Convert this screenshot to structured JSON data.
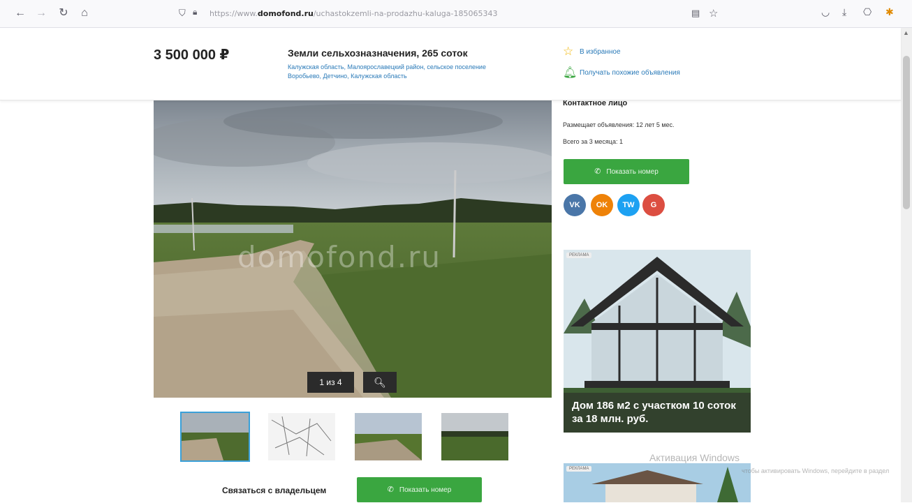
{
  "browser": {
    "url_prefix": "https://www.",
    "url_domain": "domofond.ru",
    "url_path": "/uchastokzemli-na-prodazhu-kaluga-185065343"
  },
  "listing": {
    "price": "3 500 000 ₽",
    "title": "Земли сельхозназначения, 265 соток",
    "location": "Калужская область, Малоярославецкий район, сельское поселение Воробьево, Детчино, Калужская область",
    "favorite_label": "В избранное",
    "similar_label": "Получать похожие объявления"
  },
  "gallery": {
    "watermark": "domofond.ru",
    "counter": "1 из 4",
    "thumbnails": [
      "Фото 1",
      "Фото 2",
      "Фото 3",
      "Фото 4"
    ]
  },
  "contact": {
    "title": "Контактное лицо",
    "posting_since": "Размещает объявления: 12 лет 5 мес.",
    "total_3_months": "Всего за 3 месяца: 1",
    "show_phone": "Показать номер",
    "contact_owner": "Связаться с владельцем"
  },
  "social": [
    {
      "label": "VK",
      "color": "#4a76a8"
    },
    {
      "label": "OK",
      "color": "#ee8208"
    },
    {
      "label": "TW",
      "color": "#1da1f2"
    },
    {
      "label": "G",
      "color": "#dc4e41"
    }
  ],
  "ads": {
    "badge": "РЕКЛАМА",
    "caption": "Дом 186 м2 с участком 10 соток за 18 млн. руб."
  },
  "os_overlay": {
    "activation_title": "Активация Windows",
    "activation_hint": "чтобы активировать Windows, перейдите в раздел"
  }
}
